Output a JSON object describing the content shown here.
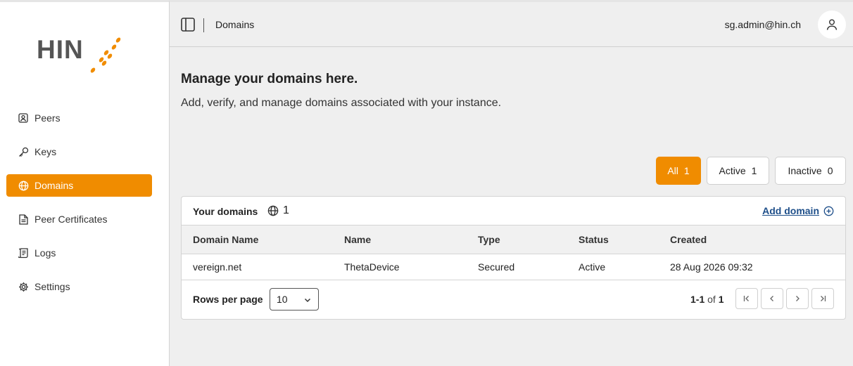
{
  "brand": {
    "logo_text": "HIN",
    "accent_color": "#f08c00"
  },
  "sidebar": {
    "items": [
      {
        "label": "Peers",
        "icon": "peers-icon",
        "active": false
      },
      {
        "label": "Keys",
        "icon": "key-icon",
        "active": false
      },
      {
        "label": "Domains",
        "icon": "globe-icon",
        "active": true
      },
      {
        "label": "Peer Certificates",
        "icon": "document-icon",
        "active": false
      },
      {
        "label": "Logs",
        "icon": "logs-icon",
        "active": false
      },
      {
        "label": "Settings",
        "icon": "gear-icon",
        "active": false
      }
    ]
  },
  "topbar": {
    "breadcrumb": "Domains",
    "user_email": "sg.admin@hin.ch"
  },
  "page": {
    "heading": "Manage your domains here.",
    "subheading": "Add, verify, and manage domains associated with your instance."
  },
  "filters": [
    {
      "label": "All",
      "count": "1",
      "active": true
    },
    {
      "label": "Active",
      "count": "1",
      "active": false
    },
    {
      "label": "Inactive",
      "count": "0",
      "active": false
    }
  ],
  "domains_card": {
    "title": "Your domains",
    "count": "1",
    "add_label": "Add domain",
    "columns": [
      "Domain Name",
      "Name",
      "Type",
      "Status",
      "Created"
    ],
    "rows": [
      [
        "vereign.net",
        "ThetaDevice",
        "Secured",
        "Active",
        "28 Aug 2026 09:32"
      ]
    ],
    "rows_per_page_label": "Rows per page",
    "rows_per_page_value": "10",
    "range": "1-1",
    "of_label": "of",
    "total": "1"
  }
}
